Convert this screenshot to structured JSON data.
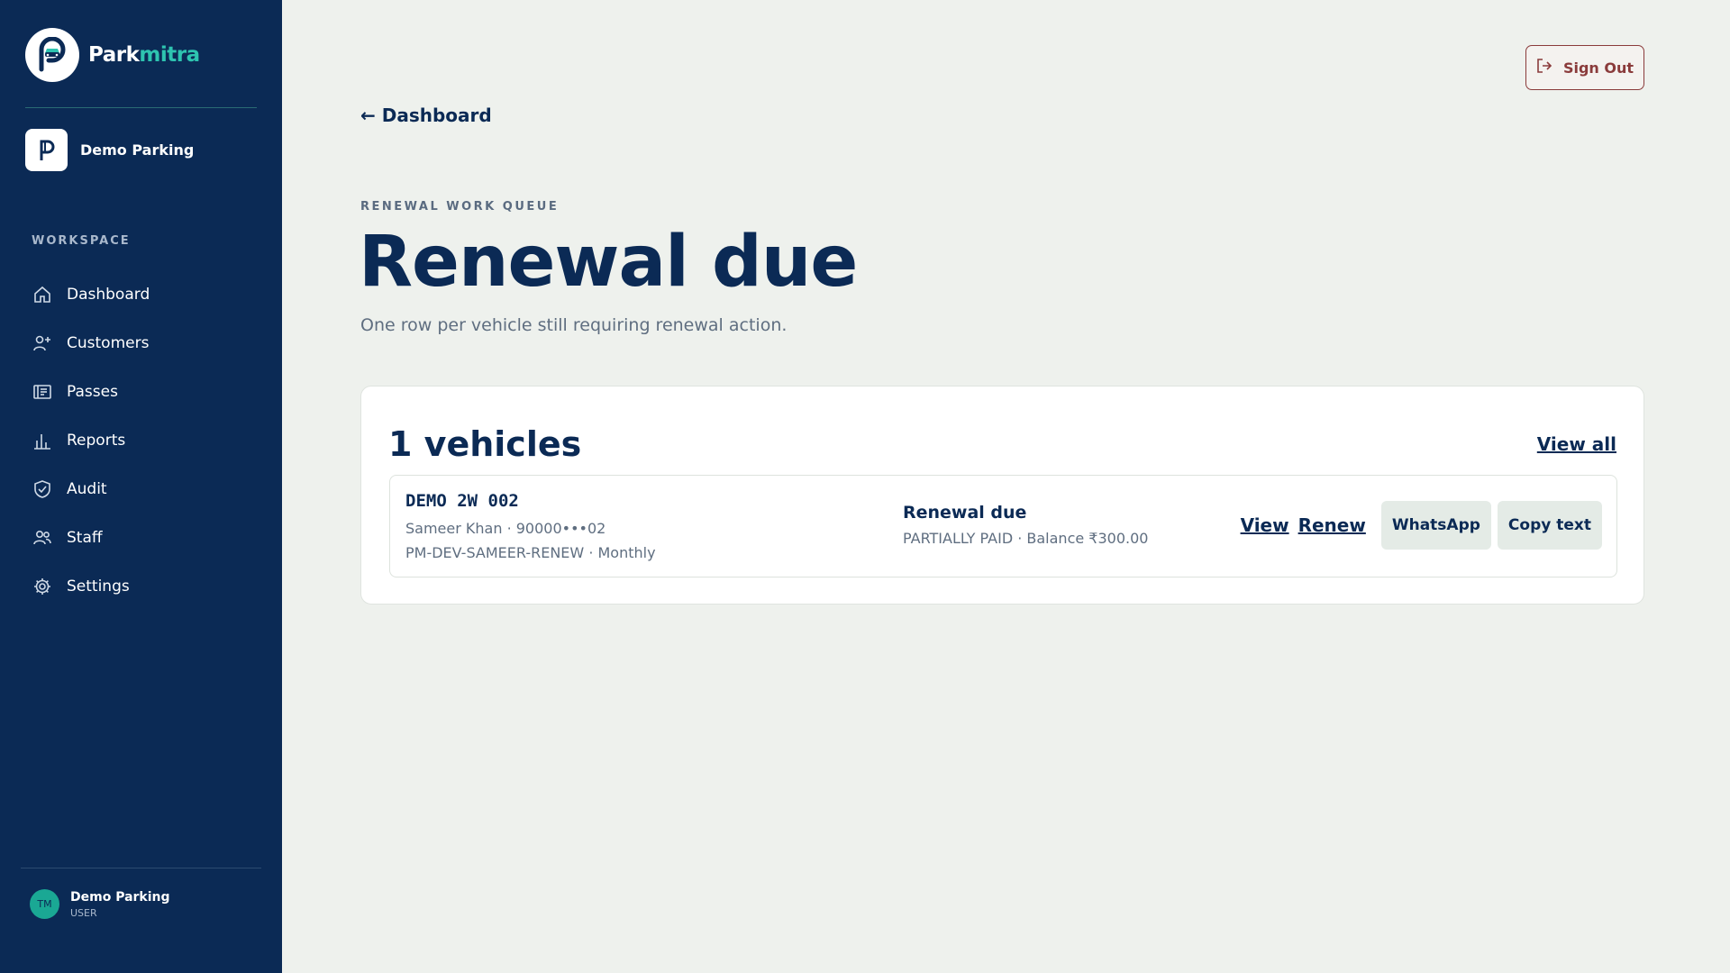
{
  "brand": {
    "name_part1": "Park",
    "name_part2": "mitra"
  },
  "org": {
    "initial": "P",
    "name": "Demo Parking"
  },
  "sidebar": {
    "section_label": "WORKSPACE",
    "items": [
      {
        "label": "Dashboard",
        "icon": "home-icon"
      },
      {
        "label": "Customers",
        "icon": "user-plus-icon"
      },
      {
        "label": "Passes",
        "icon": "id-card-icon"
      },
      {
        "label": "Reports",
        "icon": "bar-chart-icon"
      },
      {
        "label": "Audit",
        "icon": "shield-check-icon"
      },
      {
        "label": "Staff",
        "icon": "users-icon"
      },
      {
        "label": "Settings",
        "icon": "gear-icon"
      }
    ]
  },
  "user": {
    "initials": "TM",
    "name": "Demo Parking",
    "role": "USER"
  },
  "header": {
    "sign_out_label": "Sign Out",
    "back_label": "← Dashboard"
  },
  "page": {
    "eyebrow": "RENEWAL WORK QUEUE",
    "title": "Renewal due",
    "subtitle": "One row per vehicle still requiring renewal action."
  },
  "card": {
    "title": "1 vehicles",
    "view_all_label": "View all",
    "rows": [
      {
        "vehicle": "DEMO 2W 002",
        "owner": "Sameer Khan · 90000•••02",
        "pass": "PM-DEV-SAMEER-RENEW · Monthly",
        "status": "Renewal due",
        "status_detail": "PARTIALLY PAID · Balance ₹300.00",
        "actions": {
          "view": "View",
          "renew": "Renew",
          "whatsapp": "WhatsApp",
          "copy": "Copy text"
        }
      }
    ]
  },
  "colors": {
    "sidebar_bg": "#0b2a55",
    "brand_accent": "#2ec4b0",
    "page_bg": "#eef1ed",
    "sign_out": "#8a3b3b"
  }
}
